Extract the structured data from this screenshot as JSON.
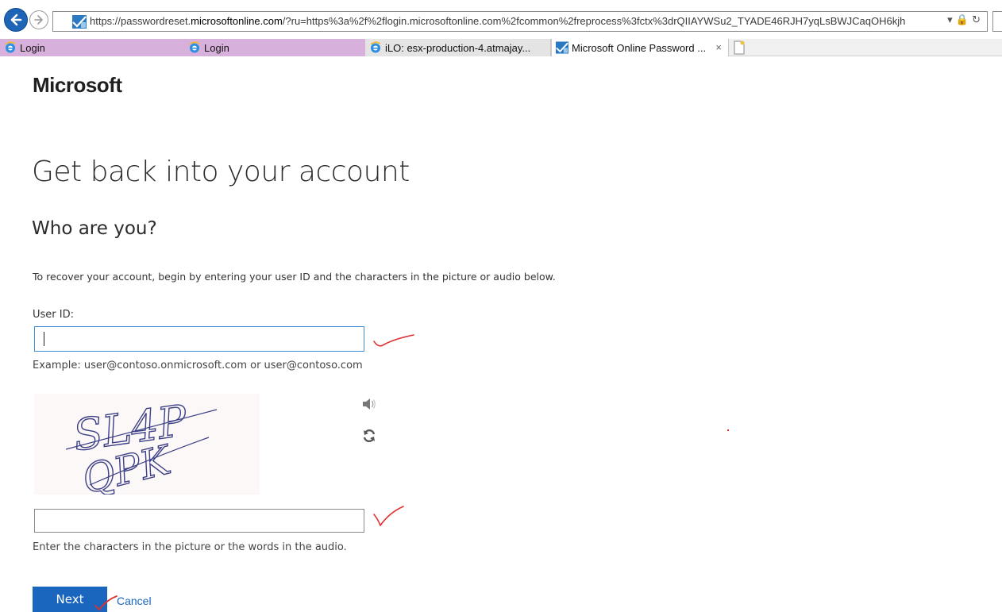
{
  "browser": {
    "url_prefix": "https://passwordreset.",
    "url_domain": "microsoftonline.com",
    "url_rest": "/?ru=https%3a%2f%2flogin.microsoftonline.com%2fcommon%2freprocess%3fctx%3drQIIAYWSu2_TYADE46RJH7yqLsBWJCaqOH6kjh",
    "url_controls": "▾ 🔒 ↻",
    "tabs": [
      {
        "label": "Login"
      },
      {
        "label": "Login"
      },
      {
        "label": "iLO: esx-production-4.atmajay..."
      },
      {
        "label": "Microsoft Online Password ...",
        "close": "×"
      }
    ]
  },
  "page": {
    "brand": "Microsoft",
    "title": "Get back into your account",
    "subtitle": "Who are you?",
    "intro": "To recover your account, begin by entering your user ID and the characters in the picture or audio below.",
    "user_id_label": "User ID:",
    "user_id_value": "",
    "example_text": "Example: user@contoso.onmicrosoft.com or user@contoso.com",
    "captcha_text": "SL4P QPK",
    "captcha_value": "",
    "captcha_help": "Enter the characters in the picture or the words in the audio.",
    "next_label": "Next",
    "cancel_label": "Cancel"
  },
  "colors": {
    "primary_blue": "#1a66be",
    "focus_border": "#3c8ed6",
    "annotation_red": "#e03030",
    "tab_purple": "#d8b0dc"
  }
}
